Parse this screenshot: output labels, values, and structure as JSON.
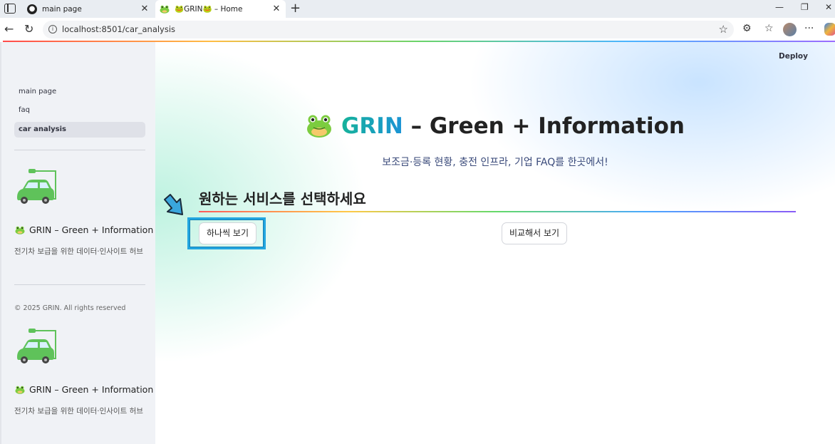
{
  "browser": {
    "tabs": [
      {
        "title": "main page",
        "favicon": "streamlit-icon",
        "active": false
      },
      {
        "title": "🐸GRIN🐸 – Home",
        "favicon": "frog-icon",
        "active": true
      }
    ],
    "url": "localhost:8501/car_analysis"
  },
  "app": {
    "deploy_label": "Deploy",
    "sidebar": {
      "nav": [
        {
          "label": "main page",
          "active": false
        },
        {
          "label": "faq",
          "active": false
        },
        {
          "label": "car analysis",
          "active": true
        }
      ],
      "brand_title": "GRIN – Green + Information",
      "brand_subtitle": "전기차 보급을 위한 데이터·인사이트 허브",
      "copyright": "© 2025 GRIN. All rights reserved"
    },
    "hero": {
      "title_accent": "GRIN",
      "title_rest": " – Green + Information",
      "subtitle": "보조금·등록 현황, 충전 인프라, 기업 FAQ를 한곳에서!"
    },
    "section_title": "원하는 서비스를 선택하세요",
    "buttons": {
      "single_view": "하나씩 보기",
      "compare_view": "비교해서 보기"
    },
    "colors": {
      "accent_teal": "#16b29a",
      "accent_blue": "#1b93d6",
      "highlight_border": "#23a6e0"
    }
  }
}
